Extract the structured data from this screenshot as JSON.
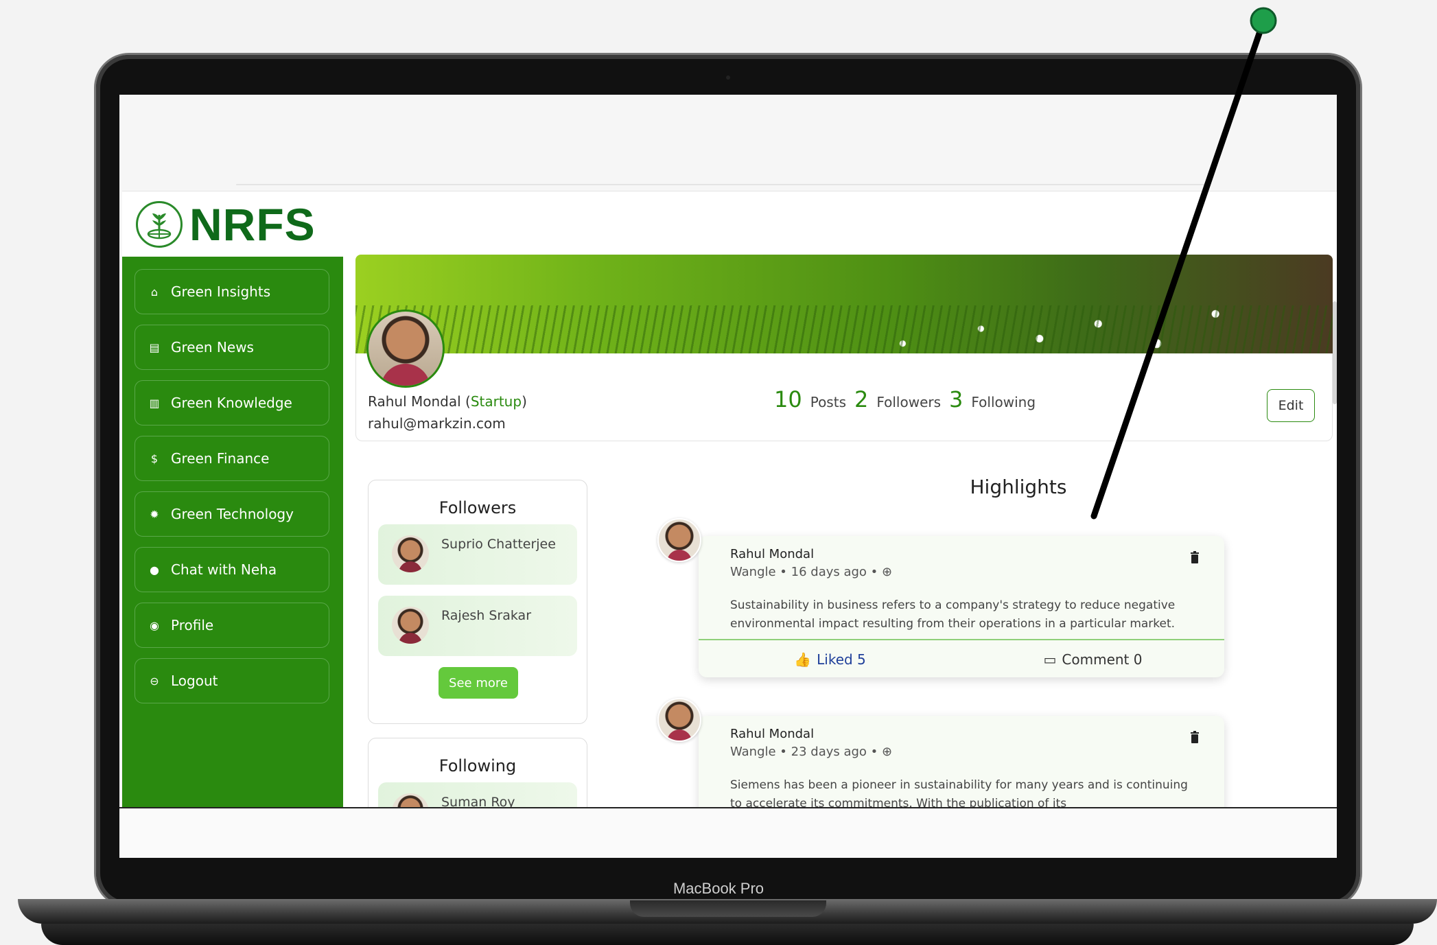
{
  "device": {
    "label": "MacBook Pro"
  },
  "app": {
    "logo_text": "NRFS"
  },
  "sidebar": {
    "items": [
      {
        "label": "Green Insights",
        "icon": "home-icon"
      },
      {
        "label": "Green News",
        "icon": "newspaper-icon"
      },
      {
        "label": "Green Knowledge",
        "icon": "book-icon"
      },
      {
        "label": "Green Finance",
        "icon": "dollar-icon"
      },
      {
        "label": "Green Technology",
        "icon": "sun-icon"
      },
      {
        "label": "Chat with Neha",
        "icon": "chat-icon"
      },
      {
        "label": "Profile",
        "icon": "user-circle-icon"
      },
      {
        "label": "Logout",
        "icon": "logout-icon"
      }
    ]
  },
  "profile": {
    "name": "Rahul Mondal",
    "role": "Startup",
    "email": "rahul@markzin.com",
    "stats": {
      "posts_count": "10",
      "posts_label": "Posts",
      "followers_count": "2",
      "followers_label": "Followers",
      "following_count": "3",
      "following_label": "Following"
    },
    "edit_label": "Edit"
  },
  "followers": {
    "title": "Followers",
    "people": [
      "Suprio Chatterjee",
      "Rajesh Srakar"
    ],
    "see_more": "See more"
  },
  "following": {
    "title": "Following",
    "people": [
      "Suman Roy"
    ]
  },
  "highlights": {
    "title": "Highlights",
    "posts": [
      {
        "author": "Rahul Mondal",
        "meta": "Wangle • 16 days ago •",
        "text": "Sustainability in business refers to a company's strategy to reduce negative environmental impact resulting from their operations in a particular market.",
        "liked_label": "Liked 5",
        "comment_label": "Comment 0"
      },
      {
        "author": "Rahul Mondal",
        "meta": "Wangle • 23 days ago •",
        "text": "Siemens has been a pioneer in sustainability for many years and is continuing to accelerate its commitments. With the publication of its"
      }
    ]
  },
  "colors": {
    "sidebar": "#2a8a0f",
    "accent": "#64c93c",
    "liked": "#1f3f9a",
    "pin": "#1e9e4a"
  }
}
